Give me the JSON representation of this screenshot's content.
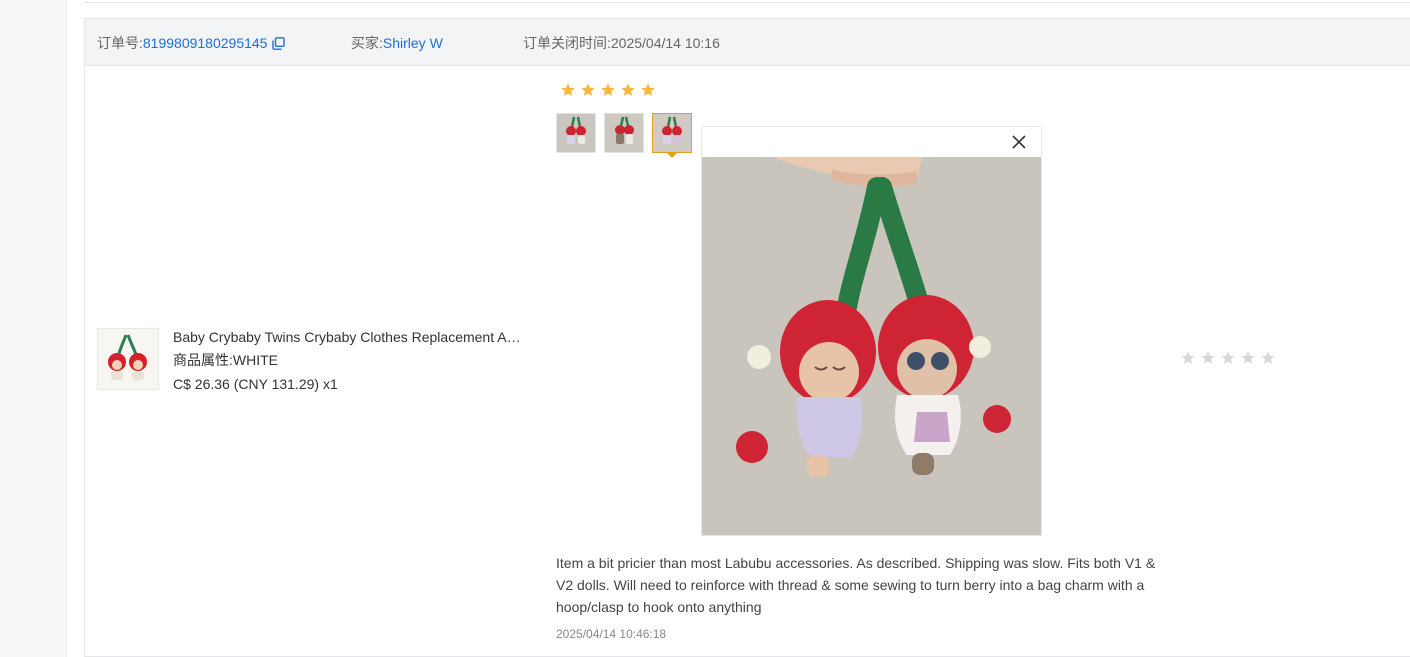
{
  "order": {
    "number_label": "订单号:",
    "number_value": "8199809180295145",
    "buyer_label": "买家:",
    "buyer_value": "Shirley W",
    "closed_text": "订单关闭时间:2025/04/14 10:16"
  },
  "product": {
    "title": "Baby Crybaby Twins Crybaby Clothes Replacement Accessories",
    "attr_label": "商品属性:",
    "attr_value": "WHITE",
    "price": "C$ 26.36 (CNY  131.29)",
    "qty": "x1"
  },
  "review": {
    "rating": 5,
    "max_rating": 5,
    "text": "Item a bit pricier than most Labubu accessories. As described. Shipping was slow. Fits both V1 & V2 dolls. Will need to reinforce with thread & some sewing to turn berry into a bag charm with a hoop/clasp to hook onto anything",
    "date": "2025/04/14 10:46:18",
    "image_count": 3,
    "selected_image": 3
  },
  "seller_rating": {
    "rating": 0,
    "max_rating": 5
  },
  "colors": {
    "link": "#1f6fd6",
    "star_filled": "#f6b73c",
    "star_empty": "#d9d9d9",
    "accent_border": "#e5a01a"
  },
  "icons": {
    "copy": "copy-icon",
    "close": "close-icon",
    "star": "star-icon"
  }
}
